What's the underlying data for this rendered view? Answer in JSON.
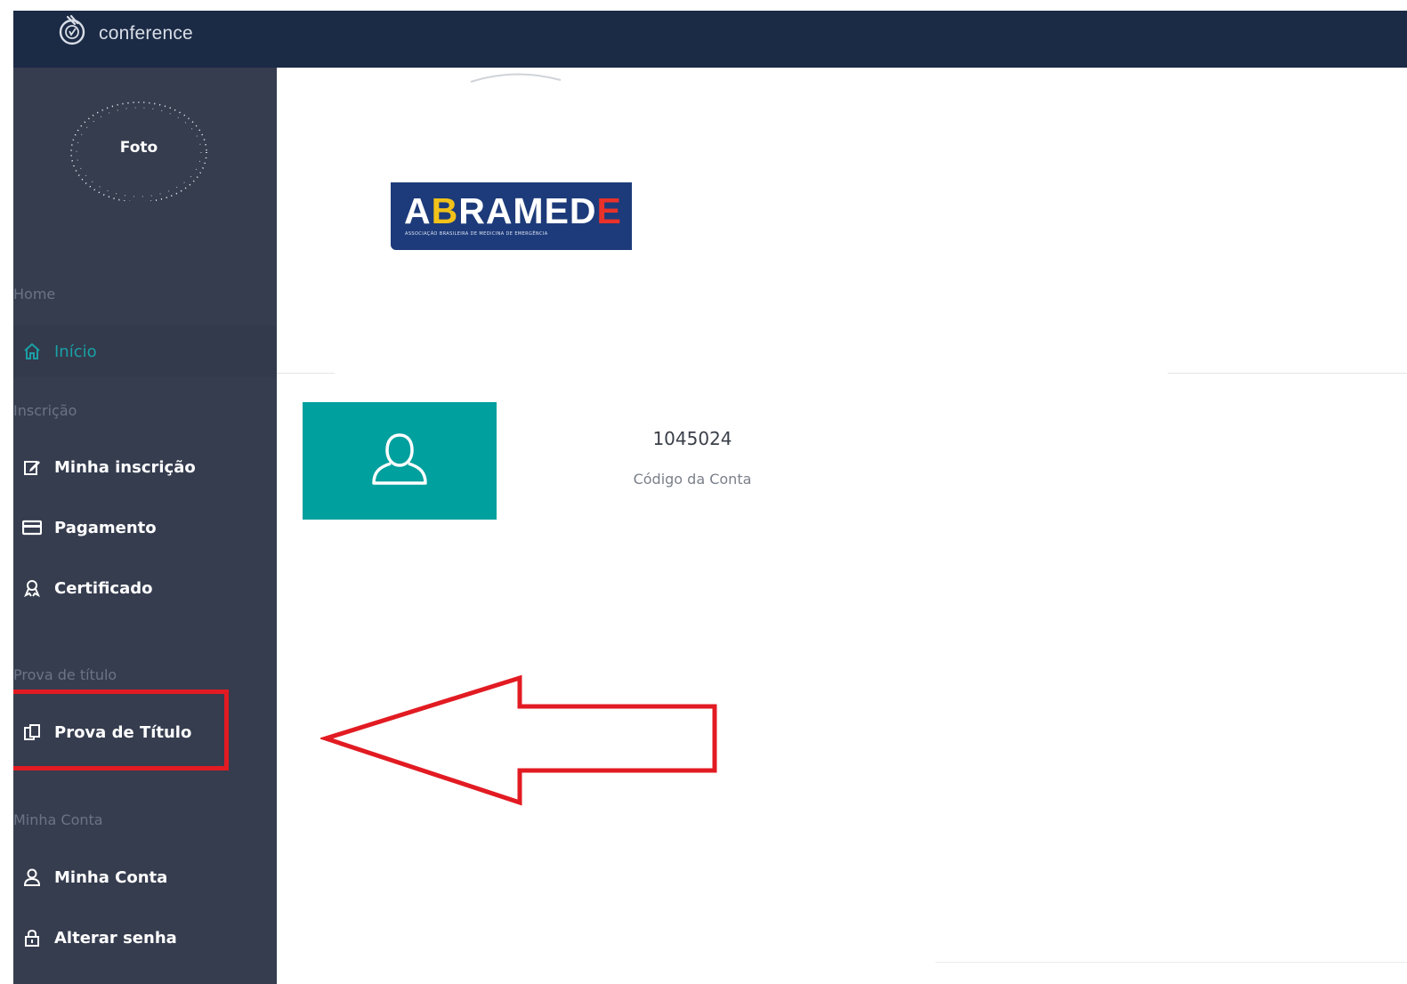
{
  "app": {
    "name": "conference"
  },
  "profile": {
    "photo_label": "Foto"
  },
  "sidebar": {
    "sections": [
      {
        "label": "Home",
        "items": [
          {
            "label": "Início",
            "icon": "home-icon",
            "active": true
          }
        ]
      },
      {
        "label": "Inscrição",
        "items": [
          {
            "label": "Minha inscrição",
            "icon": "edit-icon"
          },
          {
            "label": "Pagamento",
            "icon": "credit-card-icon"
          },
          {
            "label": "Certificado",
            "icon": "award-icon"
          }
        ]
      },
      {
        "label": "Prova de título",
        "items": [
          {
            "label": "Prova de Título",
            "icon": "copy-document-icon",
            "highlighted": true
          }
        ]
      },
      {
        "label": "Minha Conta",
        "items": [
          {
            "label": "Minha Conta",
            "icon": "user-icon"
          },
          {
            "label": "Alterar senha",
            "icon": "lock-icon"
          }
        ]
      }
    ]
  },
  "brand": {
    "logo_text_1": "A",
    "logo_text_2": "B",
    "logo_text_3": "RAMED",
    "logo_text_4": "E",
    "logo_subtitle": "ASSOCIAÇÃO BRASILEIRA DE MEDICINA DE EMERGÊNCIA"
  },
  "account": {
    "code": "1045024",
    "code_label": "Código da Conta",
    "tile_icon": "user-outline-icon"
  },
  "colors": {
    "topbar": "#1b2a45",
    "sidebar": "#363d4f",
    "accent": "#00a09e",
    "active_text": "#1aa0a6",
    "annotation_red": "#e21b22",
    "brand_blue": "#1d3b7a"
  }
}
